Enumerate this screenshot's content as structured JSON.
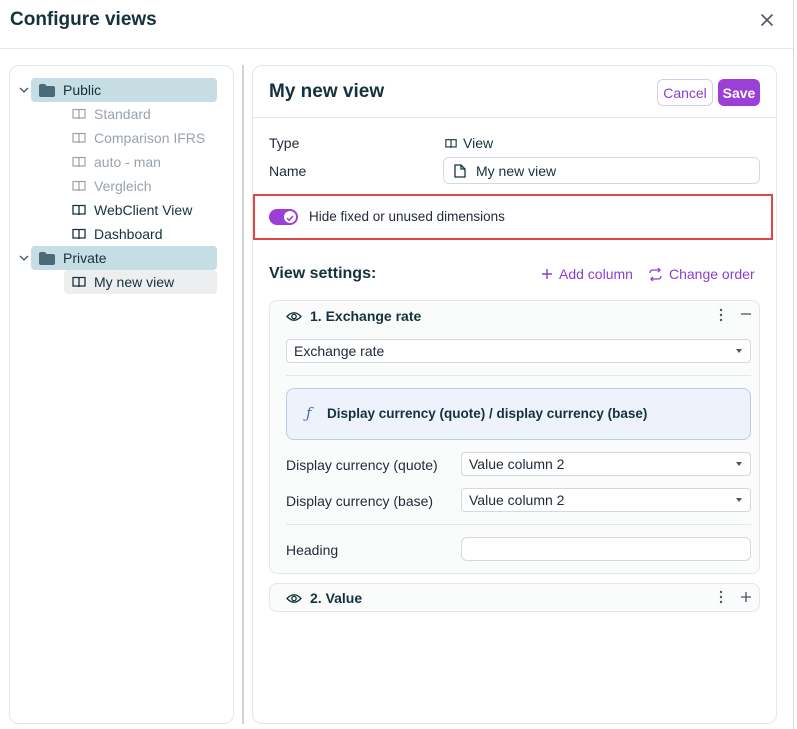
{
  "dialog": {
    "title": "Configure views"
  },
  "tree": {
    "public": {
      "label": "Public",
      "items": [
        "Standard",
        "Comparison IFRS",
        "auto - man",
        "Vergleich",
        "WebClient View",
        "Dashboard"
      ]
    },
    "private": {
      "label": "Private",
      "items": [
        "My new view"
      ]
    }
  },
  "editor": {
    "title": "My new view",
    "cancel_label": "Cancel",
    "save_label": "Save",
    "type_label": "Type",
    "type_value": "View",
    "name_label": "Name",
    "name_value": "My new view",
    "toggle_label": "Hide fixed or unused dimensions",
    "toggle_on": true,
    "settings_title": "View settings:",
    "add_column_label": "Add column",
    "change_order_label": "Change order"
  },
  "columns": [
    {
      "title": "1. Exchange rate",
      "expanded": true,
      "type_select": "Exchange rate",
      "formula": "Display currency (quote) / display currency (base)",
      "params": [
        {
          "label": "Display currency (quote)",
          "value": "Value column 2"
        },
        {
          "label": "Display currency (base)",
          "value": "Value column 2"
        }
      ],
      "heading_label": "Heading",
      "heading_value": ""
    },
    {
      "title": "2. Value",
      "expanded": false
    }
  ],
  "colors": {
    "accent": "#9b3fd6",
    "folder_bg": "#c5dde3",
    "highlight_border": "#e04646",
    "formula_bg": "#eef3fb"
  }
}
